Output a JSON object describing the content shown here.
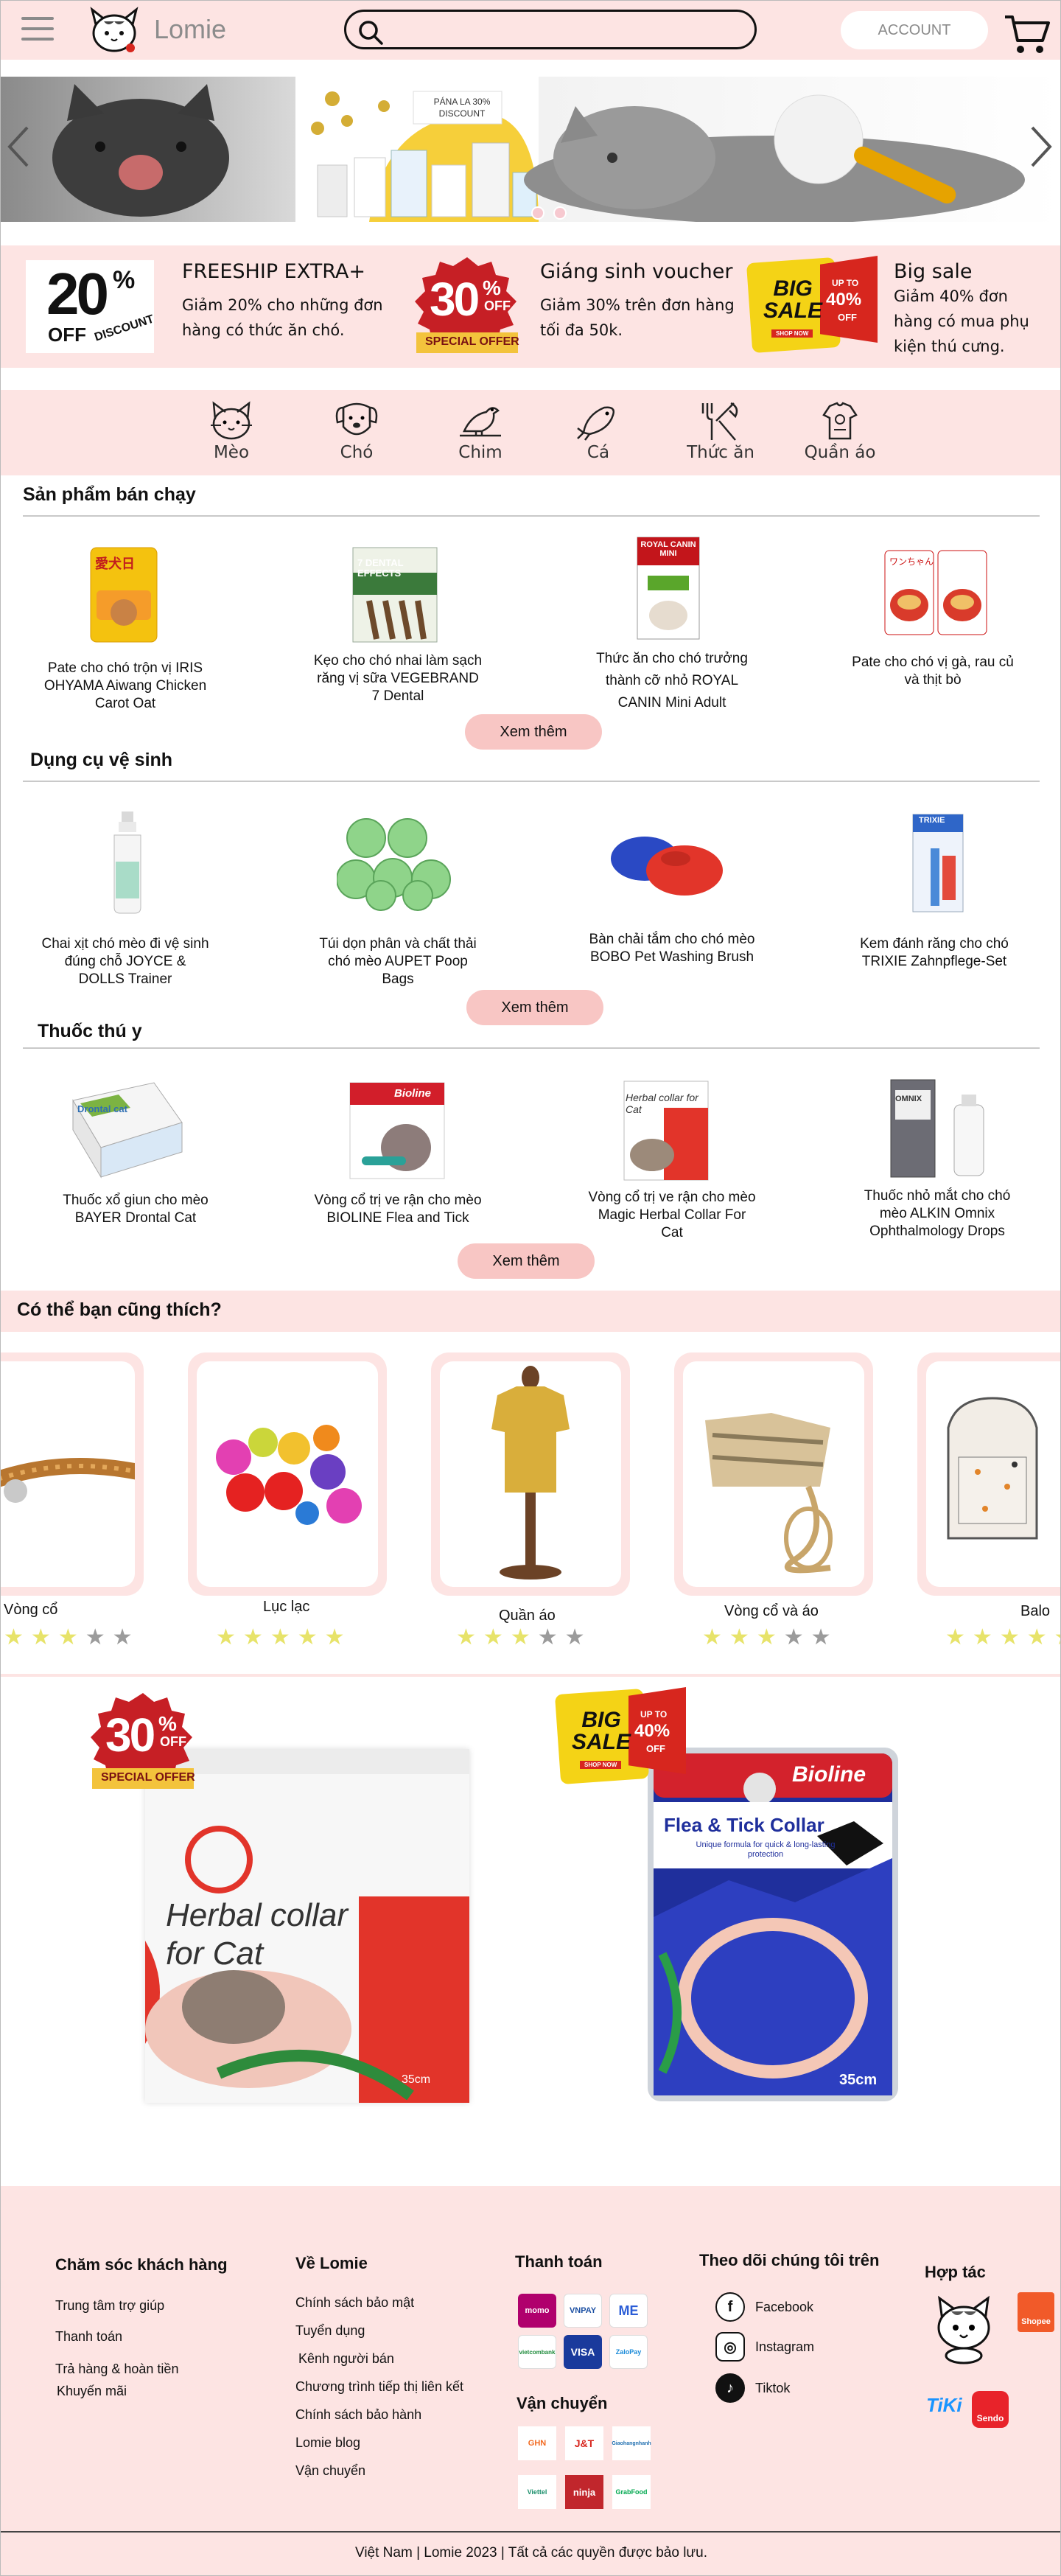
{
  "header": {
    "brand": "Lomie",
    "search_placeholder": "",
    "account_label": "ACCOUNT"
  },
  "banner": {
    "discount_sign": "PÁNA LA 30% DISCOUNT"
  },
  "promos": [
    {
      "badge_big": "20",
      "badge_pct": "%",
      "badge_off": "OFF",
      "badge_sub": "DISCOUNT",
      "title": "FREESHIP EXTRA+",
      "text": "Giảm 20% cho những đơn hàng có thức ăn chó."
    },
    {
      "badge_big": "30",
      "badge_pct": "%",
      "badge_off": "OFF",
      "badge_sub": "SPECIAL OFFER",
      "title": "Giáng sinh voucher",
      "text": "Giảm 30% trên đơn hàng tối đa 50k."
    },
    {
      "badge_big": "BIG SALE",
      "badge_upto": "UP TO",
      "badge_pct": "40%",
      "badge_off": "OFF",
      "badge_shop": "SHOP NOW",
      "title": "Big sale",
      "text": "Giảm 40% đơn hàng có mua phụ kiện thú cưng."
    }
  ],
  "categories": [
    {
      "label": "Mèo",
      "icon": "cat-icon"
    },
    {
      "label": "Chó",
      "icon": "dog-icon"
    },
    {
      "label": "Chim",
      "icon": "bird-icon"
    },
    {
      "label": "Cá",
      "icon": "fish-icon"
    },
    {
      "label": "Thức ăn",
      "icon": "food-icon"
    },
    {
      "label": "Quần áo",
      "icon": "clothes-icon"
    }
  ],
  "sections": [
    {
      "title": "Sản phẩm bán chạy",
      "more": "Xem thêm",
      "items": [
        {
          "name": "Pate cho chó trộn vị IRIS OHYAMA Aiwang Chicken Carot Oat",
          "img_text": "愛犬日"
        },
        {
          "name": "Kẹo cho chó nhai làm sạch răng vị sữa VEGEBRAND 7 Dental",
          "img_text": "7 DENTAL EFFECTS"
        },
        {
          "name": "Thức ăn cho chó trưởng thành cỡ nhỏ ROYAL CANIN Mini Adult",
          "img_text": "ROYAL CANIN MINI"
        },
        {
          "name": "Pate cho chó vị gà, rau củ và thịt bò",
          "img_text": "ワンちゃん"
        }
      ]
    },
    {
      "title": "Dụng cụ vệ sinh",
      "more": "Xem thêm",
      "items": [
        {
          "name": "Chai xịt chó mèo đi vệ sinh đúng chỗ JOYCE & DOLLS Trainer",
          "img_text": ""
        },
        {
          "name": "Túi dọn phân và chất thải chó mèo AUPET Poop Bags",
          "img_text": ""
        },
        {
          "name": "Bàn chải tắm cho chó mèo BOBO Pet Washing Brush",
          "img_text": ""
        },
        {
          "name": "Kem đánh răng cho chó TRIXIE Zahnpflege-Set",
          "img_text": "TRIXIE"
        }
      ]
    },
    {
      "title": "Thuốc thú y",
      "more": "Xem thêm",
      "items": [
        {
          "name": "Thuốc xổ giun cho mèo BAYER Drontal Cat",
          "img_text": "Drontal cat"
        },
        {
          "name": "Vòng cổ trị ve rận cho mèo BIOLINE Flea and Tick",
          "img_text": "Bioline"
        },
        {
          "name": "Vòng cổ trị ve rận cho mèo Magic Herbal Collar For Cat",
          "img_text": "Herbal collar for Cat"
        },
        {
          "name": "Thuốc nhỏ mắt cho chó mèo ALKIN Omnix Ophthalmology Drops",
          "img_text": "OMNIX"
        }
      ]
    }
  ],
  "suggest": {
    "title": "Có thể bạn cũng thích?",
    "items": [
      {
        "label": "Vòng cổ",
        "rating": 3
      },
      {
        "label": "Lục lạc",
        "rating": 5
      },
      {
        "label": "Quần áo",
        "rating": 3
      },
      {
        "label": "Vòng cổ và áo",
        "rating": 3
      },
      {
        "label": "Balo",
        "rating": 5
      }
    ]
  },
  "ads": {
    "left": {
      "badge_big": "30",
      "badge_pct": "%",
      "badge_off": "OFF",
      "badge_sub": "SPECIAL OFFER",
      "box_text": "Herbal collar for Cat",
      "box_size": "35cm"
    },
    "right": {
      "badge_big": "BIG SALE",
      "badge_upto": "UP TO",
      "badge_pct": "40%",
      "badge_off": "OFF",
      "badge_shop": "SHOP NOW",
      "brand": "Bioline",
      "box_title": "Flea & Tick Collar",
      "box_sub": "Unique formula for quick & long-lasting protection",
      "box_size": "35cm"
    }
  },
  "footer": {
    "care": {
      "title": "Chăm sóc khách hàng",
      "links": [
        "Trung tâm trợ giúp",
        "Thanh toán",
        "Trả hàng & hoàn tiền",
        "Khuyến mãi"
      ]
    },
    "about": {
      "title": "Về Lomie",
      "links": [
        "Chính sách bảo mật",
        "Tuyển dụng",
        "Kênh người bán",
        "Chương trình tiếp thị liên kết",
        "Chính sách bảo hành",
        "Lomie blog",
        "Vận chuyển"
      ]
    },
    "payment": {
      "title": "Thanh toán",
      "methods": [
        "momo",
        "VNPAY",
        "ME",
        "vietcombank",
        "VISA",
        "ZaloPay"
      ]
    },
    "shipping": {
      "title": "Vận chuyển",
      "methods": [
        "GHN",
        "J&T",
        "Giaohangnhanh",
        "Viettel",
        "ninja",
        "GrabFood"
      ]
    },
    "social": {
      "title": "Theo dõi chúng tôi trên",
      "links": [
        {
          "label": "Facebook",
          "icon": "facebook-icon"
        },
        {
          "label": "Instagram",
          "icon": "instagram-icon"
        },
        {
          "label": "Tiktok",
          "icon": "tiktok-icon"
        }
      ]
    },
    "partners": {
      "title": "Hợp tác",
      "names": [
        "Shopee",
        "TiKi",
        "Sendo"
      ]
    },
    "copyright": "Việt Nam | Lomie 2023 | Tất cả các quyền được bảo lưu."
  },
  "colors": {
    "pink": "#fde4e3",
    "button_pink": "#f8c6c4",
    "star_on": "#e7e36a",
    "star_off": "#9b9b9b",
    "sale_red": "#d7261e"
  }
}
